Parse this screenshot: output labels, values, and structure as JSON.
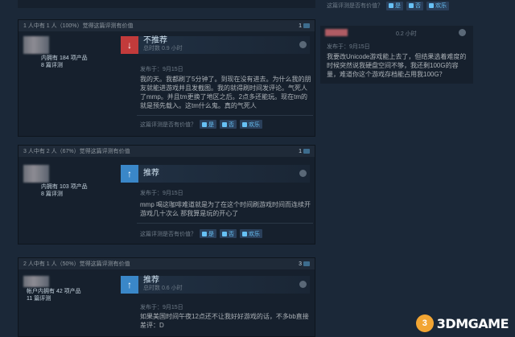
{
  "reviews": [
    {
      "helpful_summary": "1 人中有 1 人（100%）觉得这篇评测有价值",
      "comment_count": "1",
      "owned_count": "内拥有 184 项产品",
      "review_count": "8 篇评测",
      "verdict": "不推荐",
      "hours": "总时数 0.9 小时",
      "posted": "发布于：9月15日",
      "body": "我的天。我都刷了5分钟了。到现在没有进去。为什么我的朋友就能进游戏并且发截图。我的就得刷时间发评论。气死人了mmp。并且tm更换了地区之后。2点多还能玩。现在tm的就是预先载入。这tm什么鬼。真的气死人",
      "helpful_question": "这篇评测是否有价值？",
      "yes": "是",
      "no": "否",
      "funny": "欢乐"
    },
    {
      "helpful_summary": "3 人中有 2 人（67%）觉得这篇评测有价值",
      "comment_count": "1",
      "owned_count": "内拥有 103 项产品",
      "review_count": "8 篇评测",
      "verdict": "推荐",
      "hours": "",
      "posted": "发布于：9月15日",
      "body": "mmp 喝这咖啡难道就是为了在这个时间刷游戏时间而连续开游戏几十次么 那我算是玩的开心了",
      "helpful_question": "这篇评测是否有价值？",
      "yes": "是",
      "no": "否",
      "funny": "欢乐"
    },
    {
      "helpful_summary": "2 人中有 1 人（50%）觉得这篇评测有价值",
      "comment_count": "3",
      "owned_count": "帐户内拥有 42 项产品",
      "review_count": "11 篇评测",
      "verdict": "推荐",
      "hours": "总时数 0.6 小时",
      "posted": "发布于：9月15日",
      "body": "如果美国时间午夜12点还不让我好好游戏的话，不多bb直接差评：D",
      "helpful_question": "",
      "yes": "",
      "no": "",
      "funny": ""
    }
  ],
  "right": {
    "top_question": "这篇评测是否有价值？",
    "top_yes": "是",
    "top_no": "否",
    "top_funny": "欢乐",
    "hours": "0.2 小时",
    "posted": "发布于：9月15日",
    "body": "我要改Unicode游戏能上去了，但结果选着难度的时候突然说我硬盘空间不够，我还剩100G的容量，难道你这个游戏存档能占用我100G？"
  },
  "watermark": {
    "text": "3DMGAME"
  },
  "colors": {
    "background": "#1b2838",
    "card": "#16202d",
    "thumb_down": "#c23b3b",
    "thumb_up": "#3a87c8",
    "link": "#67c1f5"
  }
}
